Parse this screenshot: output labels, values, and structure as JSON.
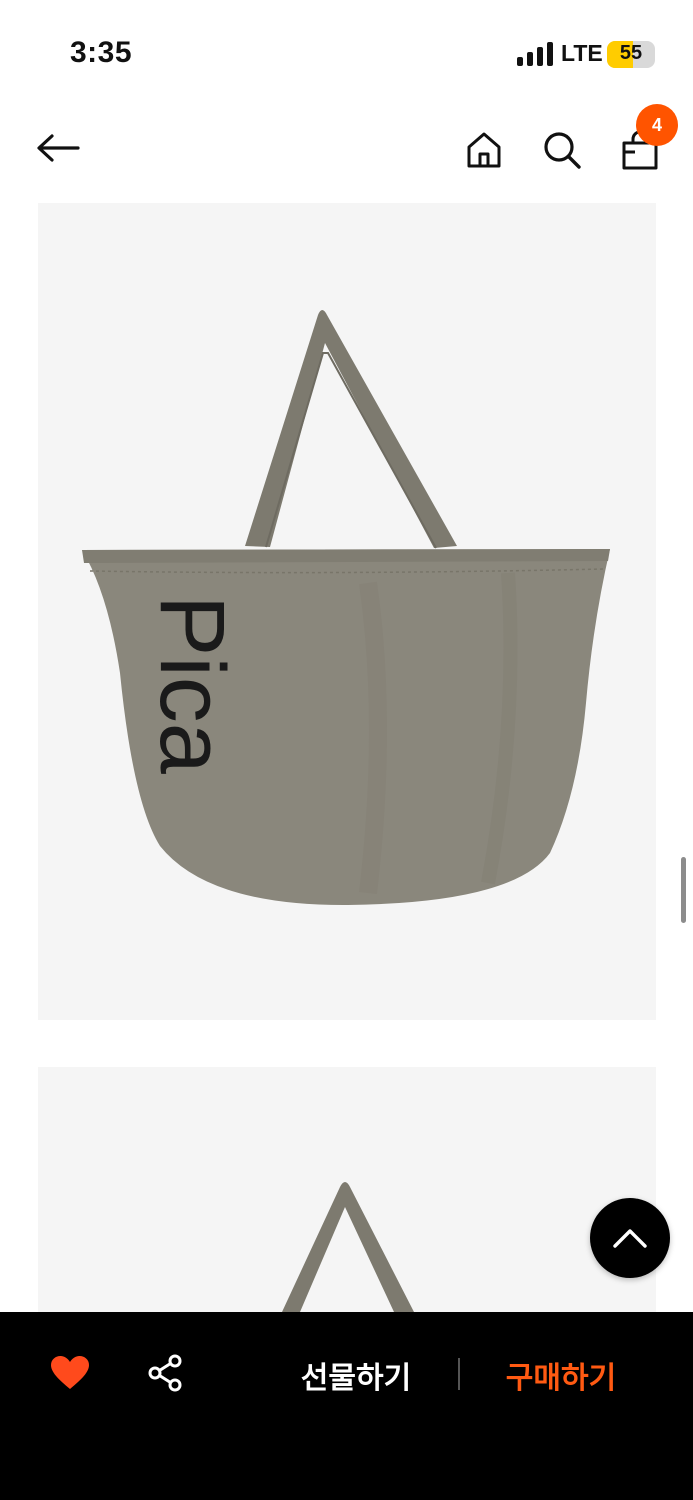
{
  "status_bar": {
    "time": "3:35",
    "network": "LTE",
    "battery": "55"
  },
  "nav": {
    "cart_count": "4",
    "icons": [
      "back-arrow-icon",
      "home-icon",
      "search-icon",
      "shopping-bag-icon"
    ]
  },
  "product": {
    "images": [
      {
        "subject": "tote-bag-front",
        "print_text": "Pica",
        "color": "#8a877c"
      },
      {
        "subject": "tote-bag-front",
        "color": "#8a877c"
      }
    ]
  },
  "bottom_bar": {
    "gift_label": "선물하기",
    "buy_label": "구매하기",
    "like_color": "#ff4a1c",
    "buy_color": "#ff5a12"
  }
}
